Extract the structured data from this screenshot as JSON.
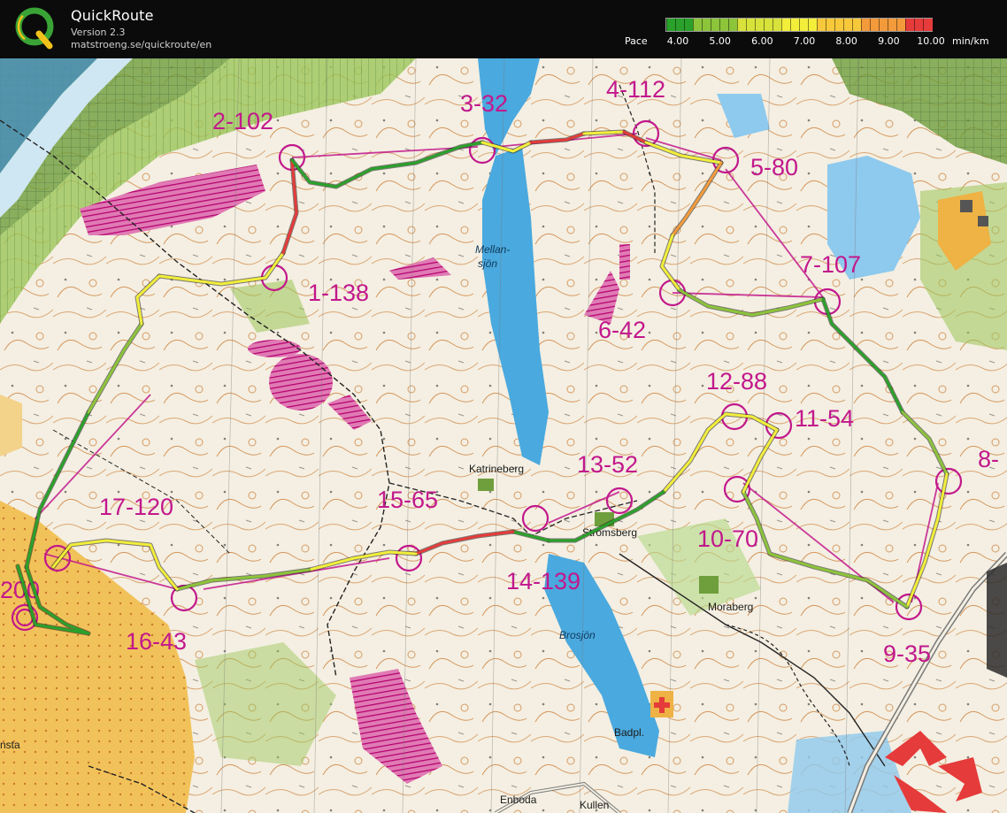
{
  "app": {
    "title": "QuickRoute",
    "version": "Version 2.3",
    "url": "matstroeng.se/quickroute/en",
    "logo_letter": "Q"
  },
  "pace_scale": {
    "label": "Pace",
    "unit": "min/km",
    "values": [
      "4.00",
      "5.00",
      "6.00",
      "7.00",
      "8.00",
      "9.00",
      "10.00"
    ],
    "colors": [
      "#2aa12a",
      "#8cc43a",
      "#d8e23a",
      "#f2ee3a",
      "#f6c83a",
      "#f39a3a",
      "#e53b3a"
    ]
  },
  "map": {
    "controls": [
      {
        "id": "1",
        "label": "1-138"
      },
      {
        "id": "2",
        "label": "2-102"
      },
      {
        "id": "3",
        "label": "3-32"
      },
      {
        "id": "4",
        "label": "4-112"
      },
      {
        "id": "5",
        "label": "5-80"
      },
      {
        "id": "6",
        "label": "6-42"
      },
      {
        "id": "7",
        "label": "7-107"
      },
      {
        "id": "8",
        "label": "8-"
      },
      {
        "id": "9",
        "label": "9-35"
      },
      {
        "id": "10",
        "label": "10-70"
      },
      {
        "id": "11",
        "label": "11-54"
      },
      {
        "id": "12",
        "label": "12-88"
      },
      {
        "id": "13",
        "label": "13-52"
      },
      {
        "id": "14",
        "label": "14-139"
      },
      {
        "id": "15",
        "label": "15-65"
      },
      {
        "id": "16",
        "label": "16-43"
      },
      {
        "id": "17",
        "label": "17-120"
      },
      {
        "id": "18",
        "label": "200"
      }
    ],
    "places": {
      "katrineberg": "Katrineberg",
      "stromsberg": "Strömsberg",
      "moraberg": "Moraberg",
      "enboda": "Enboda",
      "kullen": "Kullen",
      "badpl": "Badpl.",
      "nsta": "nsta"
    },
    "lakes": {
      "mellansjon_1": "Mellan-",
      "mellansjon_2": "sjön",
      "brosjon": "Brosjön"
    },
    "colors": {
      "terrain": "#f4efe2",
      "forest_green": "#7fb04a",
      "dark_green": "#4c8a32",
      "water": "#4aa9de",
      "purple": "#c2188c",
      "contour": "#c9772e",
      "open_yellow": "#efb244"
    }
  }
}
